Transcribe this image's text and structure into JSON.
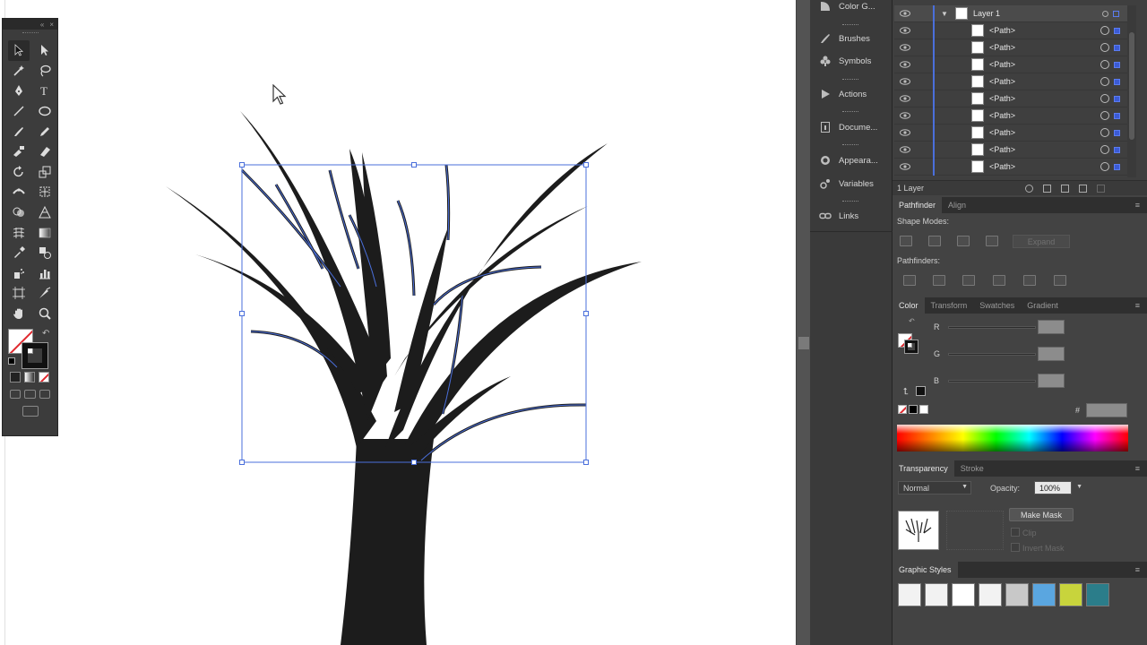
{
  "app": {
    "name": "Adobe Illustrator"
  },
  "dock": {
    "items": [
      {
        "label": "Color G...",
        "icon": "color-guide-icon"
      },
      {
        "label": "Brushes",
        "icon": "brush-icon"
      },
      {
        "label": "Symbols",
        "icon": "symbols-icon"
      },
      {
        "label": "Actions",
        "icon": "play-icon"
      },
      {
        "label": "Docume...",
        "icon": "document-info-icon"
      },
      {
        "label": "Appeara...",
        "icon": "appearance-icon"
      },
      {
        "label": "Variables",
        "icon": "variables-icon"
      },
      {
        "label": "Links",
        "icon": "links-icon"
      }
    ]
  },
  "layers": {
    "top": {
      "name": "Layer 1"
    },
    "rows": [
      "<Path>",
      "<Path>",
      "<Path>",
      "<Path>",
      "<Path>",
      "<Path>",
      "<Path>",
      "<Path>",
      "<Path>"
    ],
    "footer": "1 Layer"
  },
  "pathfinder": {
    "tabs": [
      "Pathfinder",
      "Align"
    ],
    "shape_modes_label": "Shape Modes:",
    "expand_label": "Expand",
    "pathfinders_label": "Pathfinders:"
  },
  "color": {
    "tabs": [
      "Color",
      "Transform",
      "Swatches",
      "Gradient"
    ],
    "channels": [
      "R",
      "G",
      "B"
    ],
    "hex_label": "#"
  },
  "transparency": {
    "tabs": [
      "Transparency",
      "Stroke"
    ],
    "blend_mode": "Normal",
    "opacity_label": "Opacity:",
    "opacity_value": "100%",
    "make_mask_label": "Make Mask",
    "clip_label": "Clip",
    "invert_mask_label": "Invert Mask"
  },
  "graphic_styles": {
    "tab": "Graphic Styles",
    "swatches": [
      "#f2f2f2",
      "#f2f2f2",
      "#ffffff",
      "#f2f2f2",
      "#c8c8c8",
      "#5aa6e0",
      "#c8d43c",
      "#2b7d8a"
    ]
  },
  "colors": {
    "selection": "#4a6fdb",
    "panel_bg": "#434343",
    "art": "#1c1c1c"
  }
}
